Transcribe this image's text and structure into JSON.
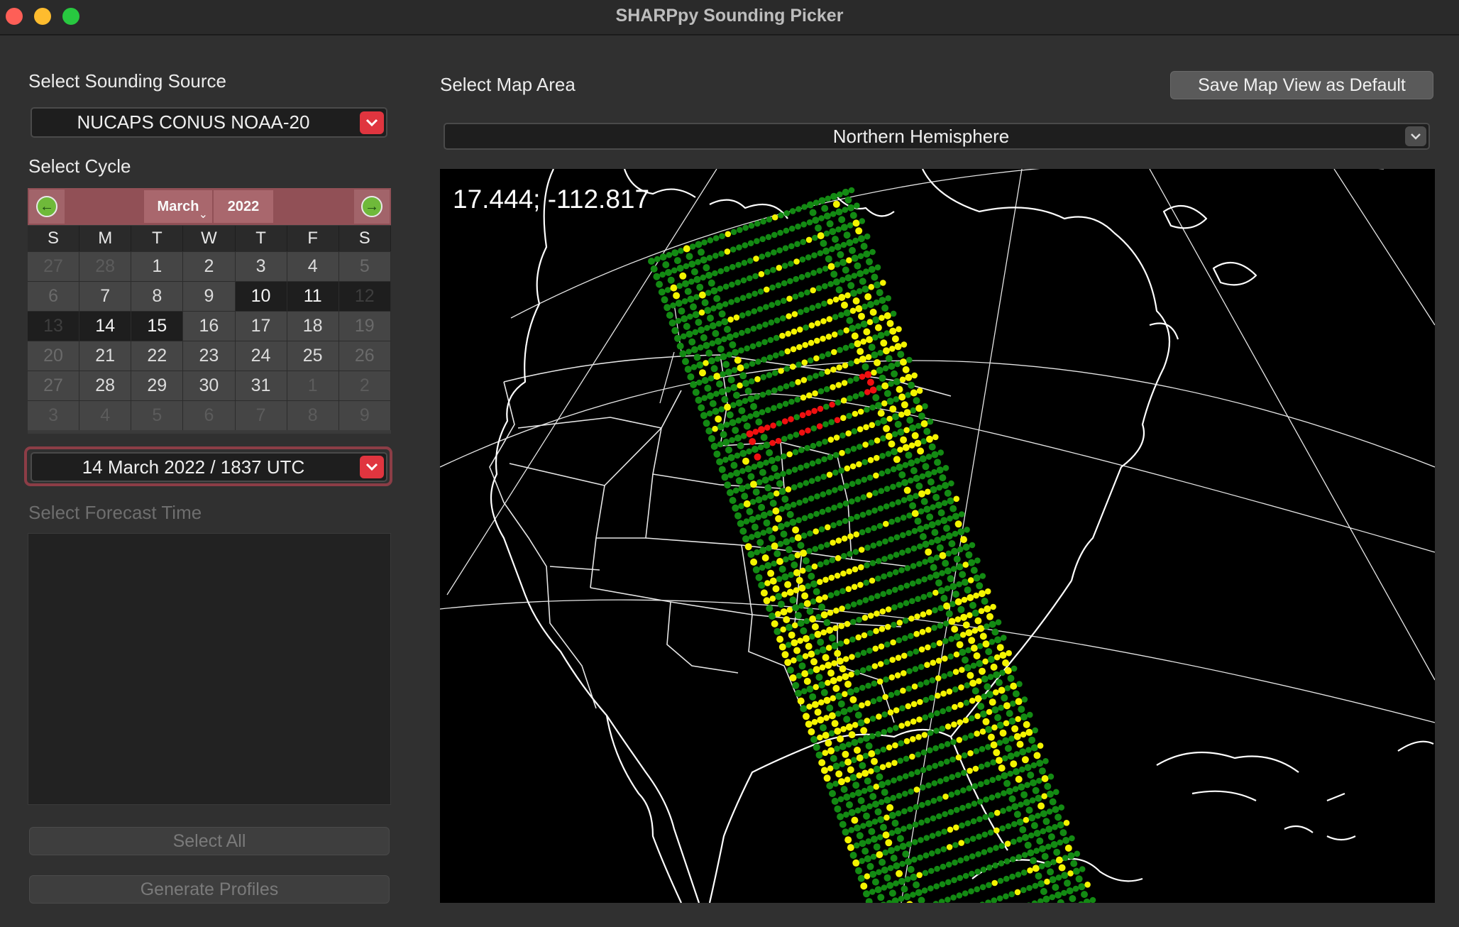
{
  "window": {
    "title": "SHARPpy Sounding Picker"
  },
  "source": {
    "label": "Select Sounding Source",
    "selected": "NUCAPS CONUS NOAA-20"
  },
  "cycle": {
    "label": "Select Cycle",
    "month": "March",
    "year": "2022",
    "weekdays": [
      "S",
      "M",
      "T",
      "W",
      "T",
      "F",
      "S"
    ],
    "days": [
      [
        "27",
        "28",
        "1",
        "2",
        "3",
        "4",
        "5"
      ],
      [
        "6",
        "7",
        "8",
        "9",
        "10",
        "11",
        "12"
      ],
      [
        "13",
        "14",
        "15",
        "16",
        "17",
        "18",
        "19"
      ],
      [
        "20",
        "21",
        "22",
        "23",
        "24",
        "25",
        "26"
      ],
      [
        "27",
        "28",
        "29",
        "30",
        "31",
        "1",
        "2"
      ],
      [
        "3",
        "4",
        "5",
        "6",
        "7",
        "8",
        "9"
      ]
    ],
    "selected_run": "14 March 2022 / 1837 UTC"
  },
  "forecast": {
    "label": "Select Forecast Time"
  },
  "buttons": {
    "select_all": "Select All",
    "generate": "Generate Profiles",
    "save_default": "Save Map View as Default"
  },
  "map": {
    "label": "Select Map Area",
    "selected_area": "Northern Hemisphere",
    "cursor_coords": "17.444; -112.817",
    "point_colors": {
      "ok": "#138a13",
      "caution": "#f4f400",
      "fail": "#f01010"
    }
  }
}
